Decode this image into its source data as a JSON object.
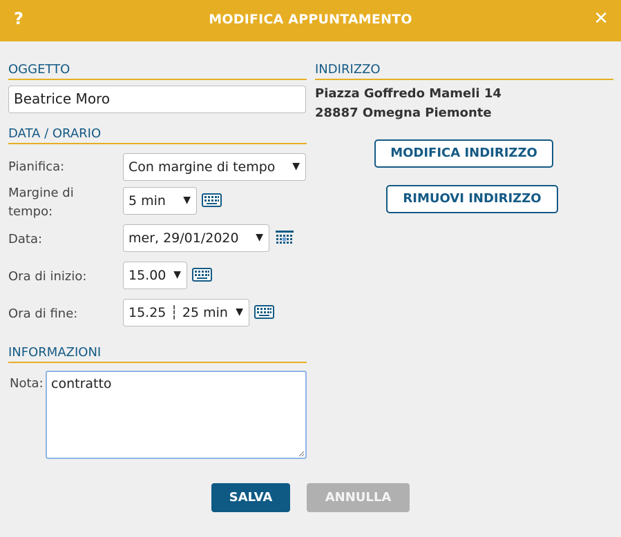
{
  "header": {
    "title": "MODIFICA APPUNTAMENTO",
    "help_glyph": "?",
    "close_glyph": "✕"
  },
  "oggetto": {
    "heading": "OGGETTO",
    "value": "Beatrice Moro"
  },
  "data_orario": {
    "heading": "DATA / ORARIO",
    "pianifica": {
      "label": "Pianifica:",
      "value": "Con margine di tempo"
    },
    "margine": {
      "label_line1": "Margine di",
      "label_line2": "tempo:",
      "value": "5 min"
    },
    "data": {
      "label": "Data:",
      "value": "mer, 29/01/2020"
    },
    "ora_inizio": {
      "label": "Ora di inizio:",
      "value": "15.00"
    },
    "ora_fine": {
      "label": "Ora di fine:",
      "value": "15.25 ┆ 25 min"
    }
  },
  "informazioni": {
    "heading": "INFORMAZIONI",
    "nota_label": "Nota:",
    "nota_value": "contratto"
  },
  "indirizzo": {
    "heading": "INDIRIZZO",
    "line1": "Piazza Goffredo Mameli 14",
    "line2": "28887 Omegna Piemonte",
    "edit_label": "MODIFICA INDIRIZZO",
    "remove_label": "RIMUOVI INDIRIZZO"
  },
  "footer": {
    "save_label": "SALVA",
    "cancel_label": "ANNULLA"
  },
  "caret_glyph": "▼",
  "colors": {
    "accent": "#e6ae22",
    "primary": "#0f5a85",
    "disabled": "#b0b0b0"
  }
}
